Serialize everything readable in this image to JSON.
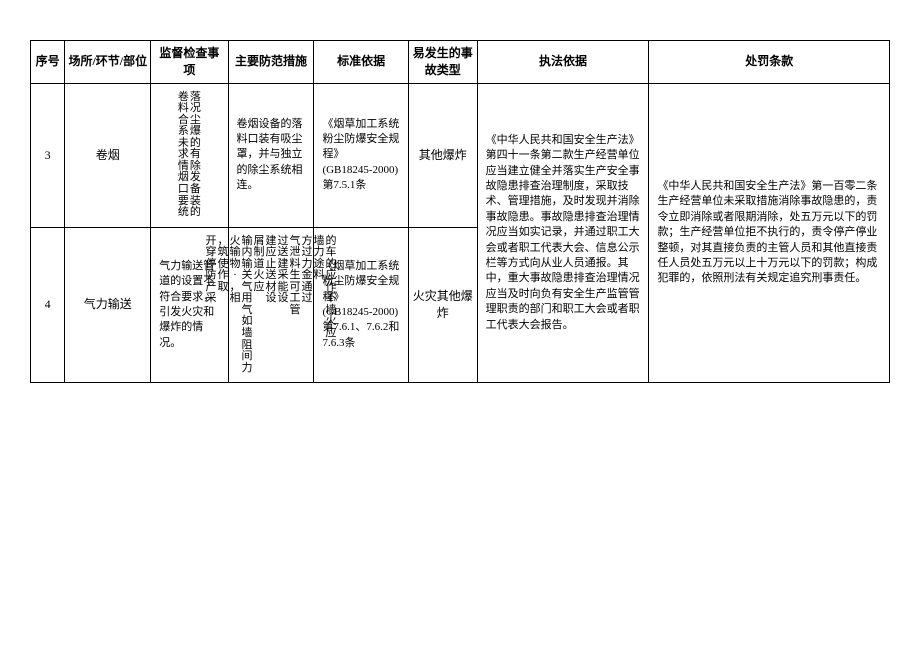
{
  "headers": {
    "seq": "序号",
    "place": "场所/环节/部位",
    "check": "监督检查事项",
    "measure": "主要防范措施",
    "standard": "标准依据",
    "accident": "易发生的事故类型",
    "law": "执法依据",
    "penalty": "处罚条款"
  },
  "rows": [
    {
      "seq": "3",
      "place": "卷烟",
      "check_col1": "卷料合系未求情烟口要统",
      "check_col2": "落况尘爆的有除发备装的",
      "measure": "卷烟设备的落料口装有吸尘罩，并与独立的除尘系统相连。",
      "standard_title": "《烟草加工系统粉尘防爆安全规程》",
      "standard_code": "(GB18245-2000)第7.5.1条",
      "accident": "其他爆炸"
    },
    {
      "seq": "4",
      "place": "气力输送",
      "check": "气力输送管道的设置不符合要求，引发火灾和爆炸的情况。",
      "measure_cols": [
        "开穿停防产采",
        "，筑使作取",
        "火输物·，相",
        "输内输关气用气如墙阻间力",
        "屑制道火应",
        "建应止送材设",
        "过送建采能设",
        "气泄料生可工管",
        "方过力金通过",
        "墙力途料",
        "的车的应作不墙火应"
      ],
      "standard_title": "《烟草加工系统粉尘防爆安全规程》",
      "standard_code": "(GB18245-2000)第7.6.1、7.6.2和7.6.3条",
      "accident": "火灾其他爆炸"
    }
  ],
  "law": "《中华人民共和国安全生产法》第四十一条第二款生产经营单位应当建立健全并落实生产安全事故隐患排查治理制度，采取技术、管理措施，及时发现并消除事故隐患。事故隐患排查治理情况应当如实记录，并通过职工大会或者职工代表大会、信息公示栏等方式向从业人员通报。其中，重大事故隐患排查治理情况应当及时向负有安全生产监管管理职责的部门和职工大会或者职工代表大会报告。",
  "penalty": "《中华人民共和国安全生产法》第一百零二条生产经营单位未采取措施消除事故隐患的，责令立即消除或者限期消除，处五万元以下的罚款；生产经营单位拒不执行的，责令停产停业整顿，对其直接负责的主管人员和其他直接责任人员处五万元以上十万元以下的罚款；构成犯罪的，依照刑法有关规定追究刑事责任。"
}
